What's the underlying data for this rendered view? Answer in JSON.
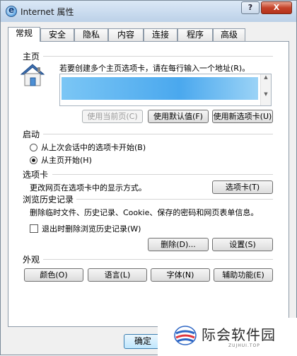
{
  "window": {
    "title": "Internet 属性",
    "help_label": "?",
    "close_label": "X"
  },
  "tabs": [
    "常规",
    "安全",
    "隐私",
    "内容",
    "连接",
    "程序",
    "高级"
  ],
  "home": {
    "section": "主页",
    "description": "若要创建多个主页选项卡，请在每行输入一个地址(R)。",
    "btn_current": "使用当前页(C)",
    "btn_default": "使用默认值(F)",
    "btn_new_tab": "使用新选项卡(U)"
  },
  "startup": {
    "section": "启动",
    "option_last_session": "从上次会话中的选项卡开始(B)",
    "option_home": "从主页开始(H)",
    "selected": "option_home"
  },
  "tabs_section": {
    "section": "选项卡",
    "description": "更改网页在选项卡中的显示方式。",
    "button": "选项卡(T)"
  },
  "history": {
    "section": "浏览历史记录",
    "description": "删除临时文件、历史记录、Cookie、保存的密码和网页表单信息。",
    "checkbox": "退出时删除浏览历史记录(W)",
    "checked": false,
    "btn_delete": "删除(D)...",
    "btn_settings": "设置(S)"
  },
  "appearance": {
    "section": "外观",
    "btn_colors": "颜色(O)",
    "btn_languages": "语言(L)",
    "btn_fonts": "字体(N)",
    "btn_accessibility": "辅助功能(E)"
  },
  "footer": {
    "ok_label": "确定"
  },
  "watermark": {
    "name": "际会软件园",
    "sub": "ZUJHUI.TOP"
  }
}
